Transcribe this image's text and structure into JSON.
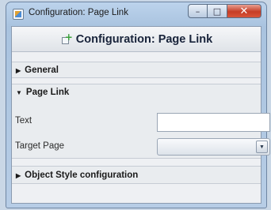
{
  "window": {
    "title": "Configuration: Page Link",
    "buttons": {
      "minimize": "–",
      "maximize": "□",
      "close": "✕"
    }
  },
  "panel": {
    "header_title": "Configuration: Page Link"
  },
  "sections": {
    "general": {
      "label": "General",
      "arrow": "▶"
    },
    "page_link": {
      "label": "Page Link",
      "arrow": "▼",
      "fields": {
        "text_label": "Text",
        "text_value": "",
        "target_label": "Target Page",
        "target_value": "",
        "dropdown_glyph": "▼"
      }
    },
    "object_style": {
      "label": "Object Style configuration",
      "arrow": "▶"
    }
  }
}
